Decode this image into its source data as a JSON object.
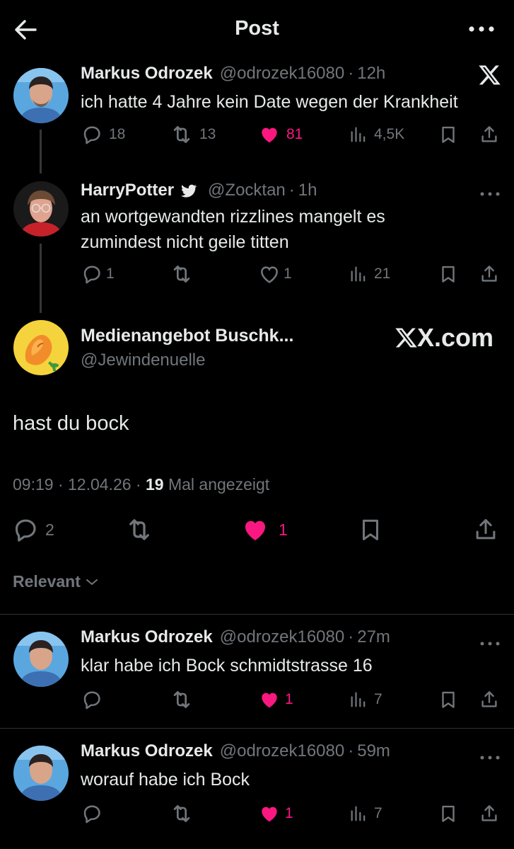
{
  "header": {
    "title": "Post"
  },
  "thread": [
    {
      "name": "Markus Odrozek",
      "handle": "@odrozek16080",
      "time": "12h",
      "text": "ich hatte 4 Jahre kein Date wegen der Krankheit",
      "replies": "18",
      "reposts": "13",
      "likes": "81",
      "views": "4,5K"
    },
    {
      "name": "HarryPotter",
      "handle": "@Zocktan",
      "time": "1h",
      "text": "an wortgewandten rizzlines mangelt es zumindest nicht geile titten",
      "replies": "1",
      "reposts": "",
      "likes": "1",
      "views": "21"
    }
  ],
  "main_post": {
    "name": "Medienangebot Buschk...",
    "handle": "@Jewindenuelle",
    "watermark": "X.com",
    "text": "hast du bock",
    "timestamp": "09:19 · 12.04.26 · ",
    "view_count": "19",
    "view_label": " Mal angezeigt",
    "replies": "2",
    "likes": "1"
  },
  "sort": {
    "label": "Relevant"
  },
  "replies": [
    {
      "name": "Markus Odrozek",
      "handle": "@odrozek16080",
      "time": "27m",
      "text": "klar habe ich Bock schmidtstrasse 16",
      "likes": "1",
      "views": "7"
    },
    {
      "name": "Markus Odrozek",
      "handle": "@odrozek16080",
      "time": "59m",
      "text": "worauf habe ich Bock",
      "likes": "1",
      "views": "7"
    }
  ],
  "colors": {
    "accent_like": "#f91880",
    "muted": "#71767b",
    "background": "#000000"
  }
}
